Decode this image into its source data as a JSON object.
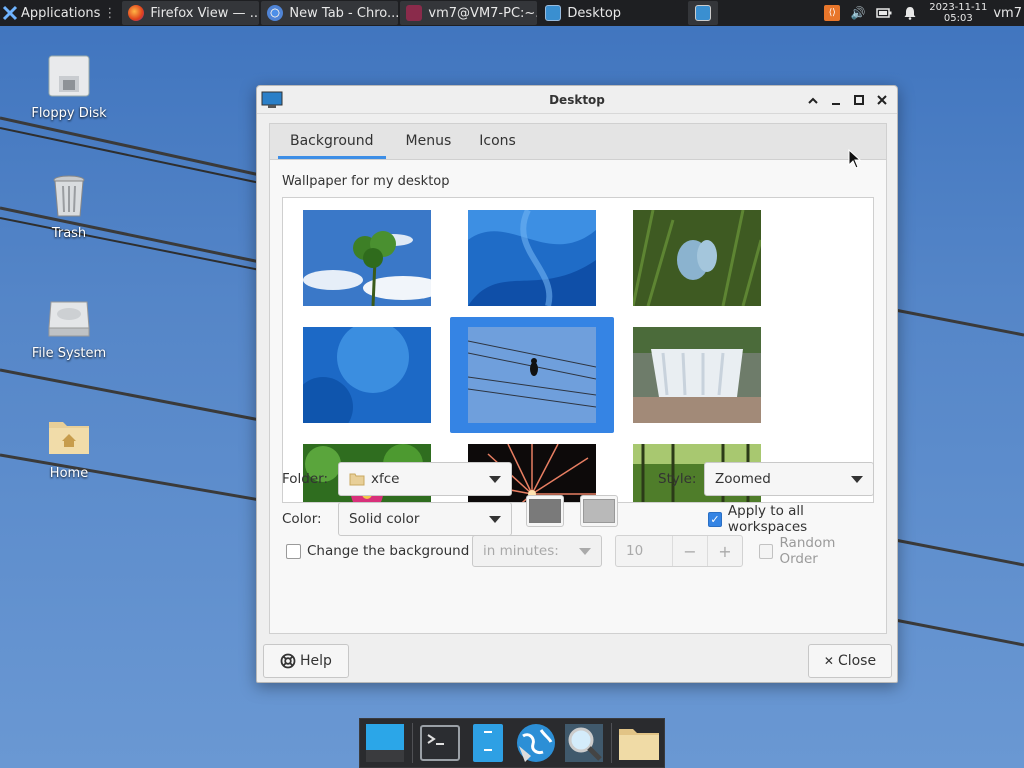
{
  "top_panel": {
    "applications_label": "Applications",
    "tasks": [
      {
        "label": "Firefox View — ...",
        "icon": "firefox-icon"
      },
      {
        "label": "New Tab - Chro...",
        "icon": "chrome-icon"
      },
      {
        "label": "vm7@VM7-PC:~...",
        "icon": "terminal-icon"
      },
      {
        "label": "Desktop",
        "icon": "desktop-settings-icon"
      }
    ],
    "clock_date": "2023-11-11",
    "clock_time": "05:03",
    "user": "vm7"
  },
  "desktop_icons": [
    {
      "label": "Floppy Disk",
      "icon": "floppy-disk-icon"
    },
    {
      "label": "Trash",
      "icon": "trash-icon"
    },
    {
      "label": "File System",
      "icon": "hard-drive-icon"
    },
    {
      "label": "Home",
      "icon": "home-folder-icon"
    }
  ],
  "dialog": {
    "title": "Desktop",
    "tabs": [
      "Background",
      "Menus",
      "Icons"
    ],
    "active_tab": "Background",
    "wallpaper_label": "Wallpaper for my desktop",
    "wallpapers": [
      {
        "name": "clover-sky"
      },
      {
        "name": "blue-abstract-waves"
      },
      {
        "name": "butterfly-grass"
      },
      {
        "name": "blue-soft-shapes"
      },
      {
        "name": "bird-on-wires",
        "selected": true
      },
      {
        "name": "waterfall"
      },
      {
        "name": "pink-flower-leaves"
      },
      {
        "name": "fireworks"
      },
      {
        "name": "green-forest-river"
      }
    ],
    "folder_label": "Folder:",
    "folder_value": "xfce",
    "style_label": "Style:",
    "style_value": "Zoomed",
    "color_label": "Color:",
    "color_value": "Solid color",
    "color_primary": "#7a7a7a",
    "color_secondary": "#b9b9b9",
    "apply_all_label": "Apply to all workspaces",
    "apply_all_checked": true,
    "change_bg_label": "Change the background",
    "change_bg_checked": false,
    "interval_unit": "in minutes:",
    "interval_value": "10",
    "random_order_label": "Random Order",
    "help_label": "Help",
    "close_label": "Close"
  },
  "dock": {
    "items": [
      "show-desktop-icon",
      "terminal-icon",
      "file-manager-icon",
      "web-browser-icon",
      "app-finder-icon",
      "folder-icon"
    ]
  },
  "colors": {
    "accent": "#3584e4",
    "panel_bg": "#1e1f22",
    "desktop_bg": "#5586c8"
  }
}
